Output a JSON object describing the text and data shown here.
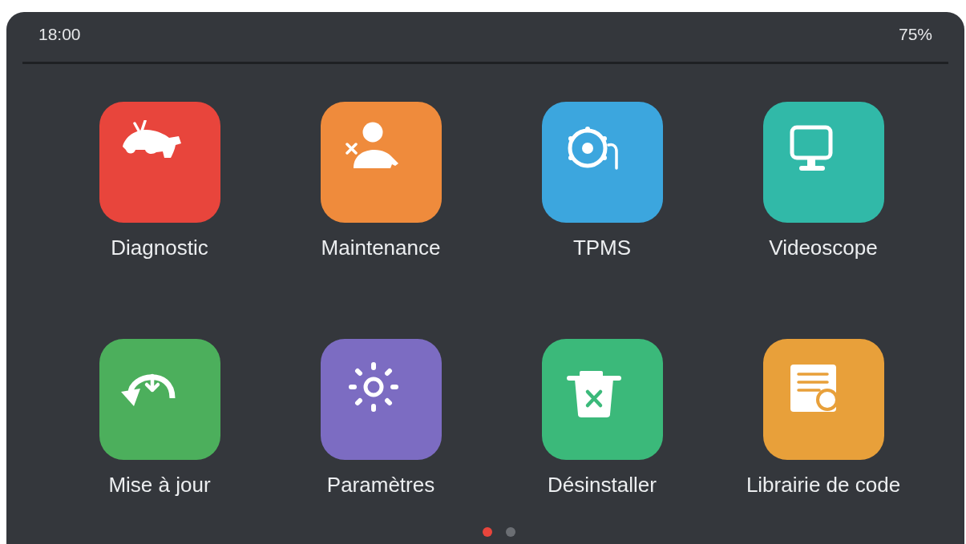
{
  "status_bar": {
    "time": "18:00",
    "battery": "75%"
  },
  "apps": [
    {
      "label": "Diagnostic",
      "color": "#e8453c"
    },
    {
      "label": "Maintenance",
      "color": "#ef8b3c"
    },
    {
      "label": "TPMS",
      "color": "#3ca6de"
    },
    {
      "label": "Videoscope",
      "color": "#31b9a8"
    },
    {
      "label": "Mise à jour",
      "color": "#4caf5c"
    },
    {
      "label": "Paramètres",
      "color": "#7c6cc2"
    },
    {
      "label": "Désinstaller",
      "color": "#3bb97a"
    },
    {
      "label": "Librairie de code",
      "color": "#e8a03a"
    }
  ],
  "page_indicator": [
    {
      "selected": true
    },
    {
      "selected": false
    }
  ]
}
